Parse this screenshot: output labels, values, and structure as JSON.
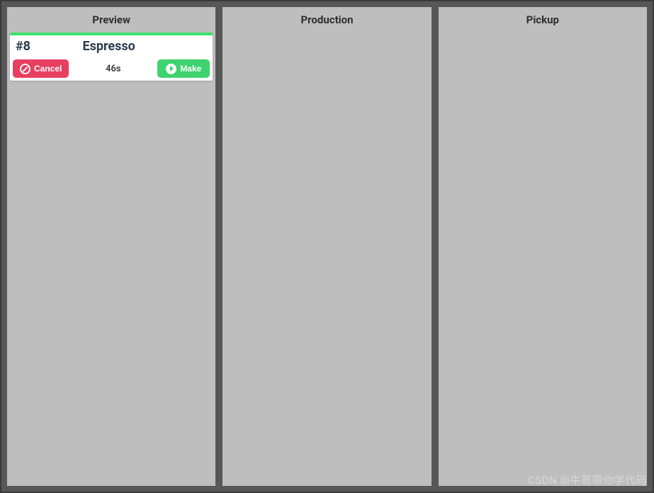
{
  "columns": {
    "preview": {
      "title": "Preview"
    },
    "production": {
      "title": "Production"
    },
    "pickup": {
      "title": "Pickup"
    }
  },
  "order": {
    "id": "#8",
    "name": "Espresso",
    "timer": "46s",
    "cancel_label": "Cancel",
    "make_label": "Make"
  },
  "watermark": "CSDN @牛哥带你学代码"
}
